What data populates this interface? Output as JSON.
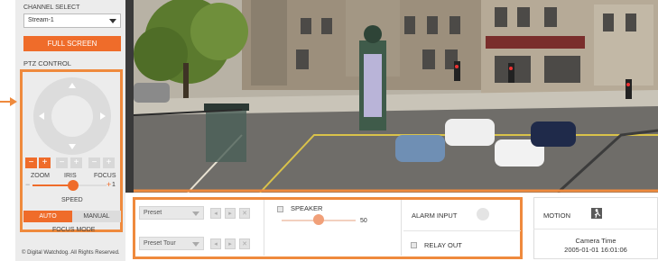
{
  "channel": {
    "label": "CHANNEL SELECT",
    "value": "Stream-1"
  },
  "fullscreen_label": "FULL SCREEN",
  "ptz": {
    "label": "PTZ CONTROL",
    "zoom_label": "ZOOM",
    "iris_label": "IRIS",
    "focus_label": "FOCUS",
    "minus": "−",
    "plus": "+",
    "speed_label": "SPEED",
    "speed_value": "1",
    "speed_fraction": 0.55
  },
  "focus_mode": {
    "auto": "AUTO",
    "manual": "MANUAL",
    "label": "FOCUS MODE"
  },
  "copyright": "© Digital Watchdog. All Rights Reserved.",
  "presets": {
    "preset_placeholder": "Preset",
    "tour_placeholder": "Preset Tour"
  },
  "speaker": {
    "label": "SPEAKER",
    "value": "50",
    "fraction": 0.5
  },
  "alarm": {
    "input_label": "ALARM INPUT",
    "relay_label": "RELAY OUT"
  },
  "motion": {
    "label": "MOTION"
  },
  "camera_time": {
    "title": "Camera Time",
    "value": "2005-01-01 16:01:06"
  },
  "colors": {
    "accent": "#ef6c2a",
    "highlight_border": "#ef8a3d"
  },
  "icons": {
    "joystick": "ptz-joystick-icon",
    "motion": "motion-icon",
    "pointer": "arrow-right-icon"
  }
}
